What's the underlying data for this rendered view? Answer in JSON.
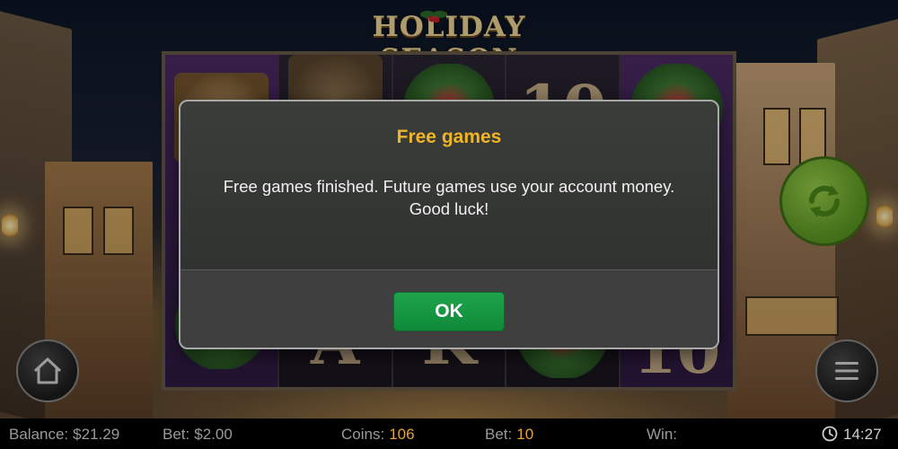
{
  "game": {
    "title": "HOLIDAY SEASON"
  },
  "dialog": {
    "title": "Free games",
    "message": "Free games finished. Future games use your account money. Good luck!",
    "ok_label": "OK"
  },
  "status_bar": {
    "balance_label": "Balance:",
    "balance_value": "$21.29",
    "bet_amount_label": "Bet:",
    "bet_amount_value": "$2.00",
    "coins_label": "Coins:",
    "coins_value": "106",
    "bet_coins_label": "Bet:",
    "bet_coins_value": "10",
    "win_label": "Win:",
    "win_value": "",
    "time": "14:27"
  },
  "reels": {
    "visible_symbols": [
      "10",
      "A",
      "K",
      "10"
    ]
  },
  "icons": {
    "home": "home-icon",
    "menu": "hamburger-menu-icon",
    "spin": "spin-refresh-icon",
    "clock": "clock-icon"
  },
  "colors": {
    "dialog_title": "#f0b428",
    "ok_button": "#169a42",
    "status_value_accent": "#e8a335",
    "spin_button": "#6aaa2a"
  }
}
